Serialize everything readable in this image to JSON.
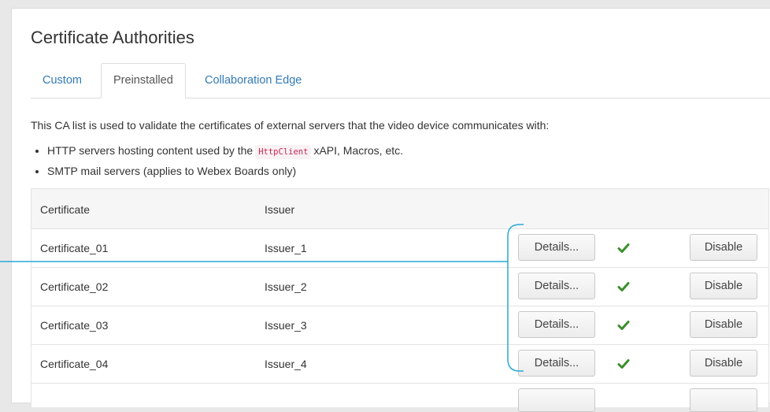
{
  "title": "Certificate Authorities",
  "tabs": [
    {
      "label": "Custom",
      "active": false
    },
    {
      "label": "Preinstalled",
      "active": true
    },
    {
      "label": "Collaboration Edge",
      "active": false
    }
  ],
  "description": "This CA list is used to validate the certificates of external servers that the video device communicates with:",
  "bullets": {
    "item1_prefix": "HTTP servers hosting content used by the",
    "item1_code": "HttpClient",
    "item1_suffix": "xAPI, Macros, etc.",
    "item2": "SMTP mail servers (applies to Webex Boards only)"
  },
  "table": {
    "headers": {
      "certificate": "Certificate",
      "issuer": "Issuer"
    },
    "rows": [
      {
        "certificate": "Certificate_01",
        "issuer": "Issuer_1",
        "details_label": "Details...",
        "status_icon": "check-icon",
        "disable_label": "Disable"
      },
      {
        "certificate": "Certificate_02",
        "issuer": "Issuer_2",
        "details_label": "Details...",
        "status_icon": "check-icon",
        "disable_label": "Disable"
      },
      {
        "certificate": "Certificate_03",
        "issuer": "Issuer_3",
        "details_label": "Details...",
        "status_icon": "check-icon",
        "disable_label": "Disable"
      },
      {
        "certificate": "Certificate_04",
        "issuer": "Issuer_4",
        "details_label": "Details...",
        "status_icon": "check-icon",
        "disable_label": "Disable"
      }
    ]
  },
  "colors": {
    "link": "#337ab7",
    "check": "#3c8d2f",
    "callout": "#29a8d6",
    "code_text": "#c7254e"
  }
}
